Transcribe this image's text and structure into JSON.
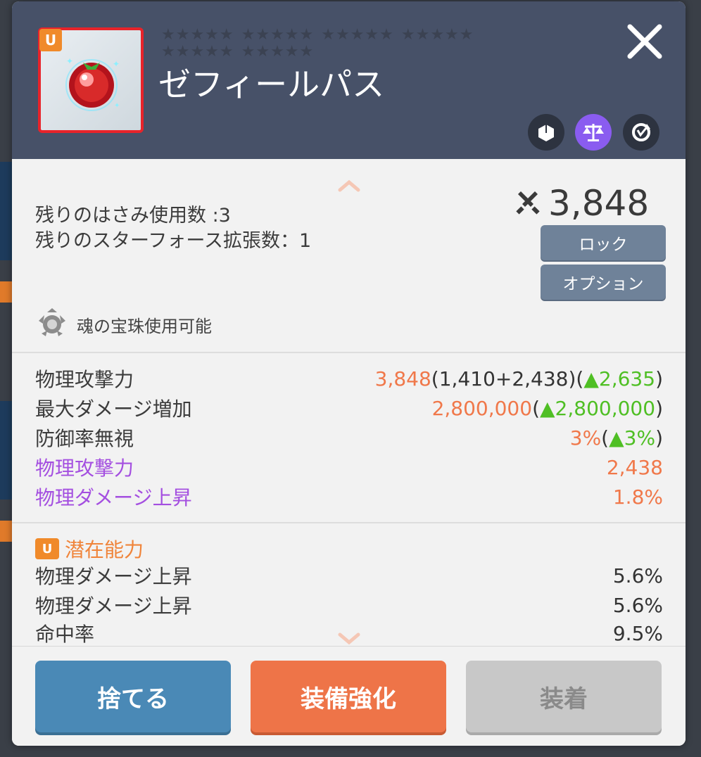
{
  "item": {
    "grade_badge": "U",
    "name": "ゼフィールパス",
    "star_groups": [
      "★★★★★",
      "★★★★★",
      "★★★★★",
      "★★★★★",
      "★★★★★",
      "★★★★★"
    ]
  },
  "info": {
    "scissors_remaining": "残りのはさみ使用数 :3",
    "starforce_expansion": "残りのスターフォース拡張数：1",
    "soul_orb": "魂の宝珠使用可能"
  },
  "power": {
    "value": "3,848"
  },
  "buttons": {
    "lock": "ロック",
    "option": "オプション",
    "discard": "捨てる",
    "enhance": "装備強化",
    "equip": "装着"
  },
  "stats": [
    {
      "label": "物理攻撃力",
      "main": "3,848",
      "detail": "(1,410+2,438)",
      "diff_open": "(",
      "diff": "▲2,635",
      "diff_close": ")"
    },
    {
      "label": "最大ダメージ増加",
      "main": "2,800,000",
      "diff_open": "(",
      "diff": "▲2,800,000",
      "diff_close": ")"
    },
    {
      "label": "防御率無視",
      "main": "3%",
      "diff_open": "(",
      "diff": "▲3%",
      "diff_close": ")"
    }
  ],
  "bonus_stats": [
    {
      "label": "物理攻撃力",
      "value": "2,438"
    },
    {
      "label": "物理ダメージ上昇",
      "value": "1.8%"
    }
  ],
  "potential": {
    "badge": "U",
    "title": "潜在能力",
    "lines": [
      {
        "label": "物理ダメージ上昇",
        "value": "5.6%"
      },
      {
        "label": "物理ダメージ上昇",
        "value": "5.6%"
      },
      {
        "label": "命中率",
        "value": "9.5%"
      }
    ]
  },
  "colors": {
    "header": "#475168",
    "grade": "#f08a2a",
    "increase": "#4fbf24",
    "value": "#f0784a",
    "bonus_label": "#a44fe0",
    "discard": "#4a89b6",
    "enhance": "#ee7448",
    "equip_disabled": "#c8c8c8"
  },
  "icons": {
    "close": "close-icon",
    "transfer": "transfer-icon",
    "scale": "scale-icon",
    "refresh": "refresh-icon",
    "power": "crossed-swords-icon",
    "soul": "soul-orb-icon"
  }
}
